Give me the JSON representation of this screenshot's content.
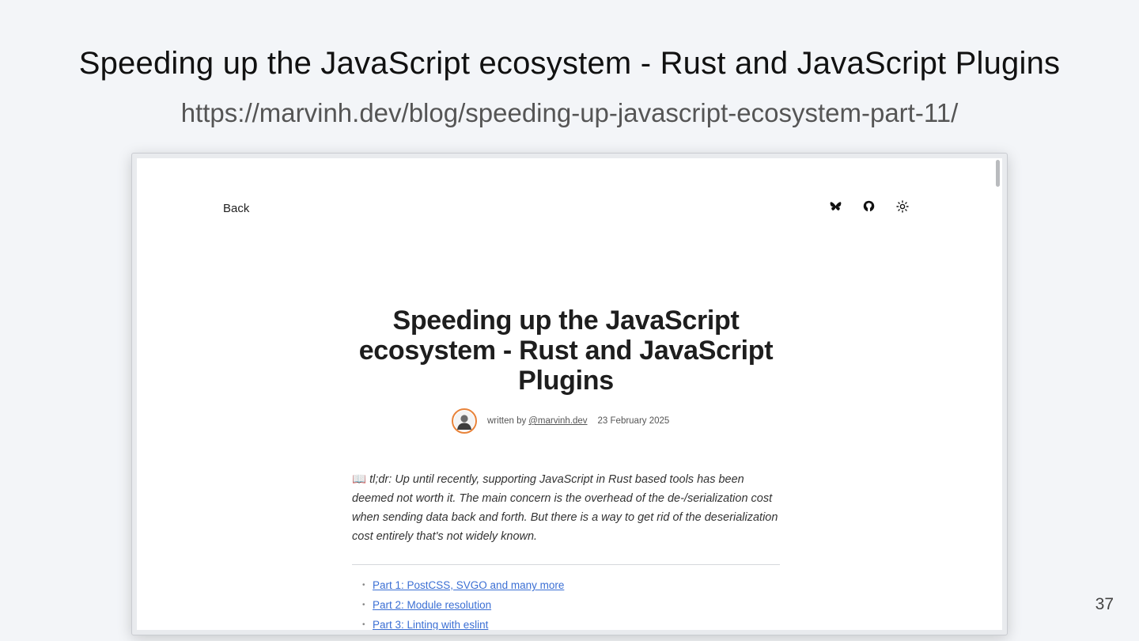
{
  "slide": {
    "title": "Speeding up the JavaScript ecosystem - Rust and JavaScript Plugins",
    "url": "https://marvinh.dev/blog/speeding-up-javascript-ecosystem-part-11/",
    "page_number": "37"
  },
  "site": {
    "back_label": "Back",
    "icons": [
      "bluesky-icon",
      "github-icon",
      "theme-toggle-icon"
    ]
  },
  "article": {
    "title": "Speeding up the JavaScript ecosystem - Rust and JavaScript Plugins",
    "byline_prefix": "written by",
    "author": "@marvinh.dev",
    "date": "23 February 2025",
    "tldr_emoji": "📖",
    "tldr": "tl;dr: Up until recently, supporting JavaScript in Rust based tools has been deemed not worth it. The main concern is the overhead of the de-/serialization cost when sending data back and forth. But there is a way to get rid of the deserialization cost entirely that's not widely known.",
    "parts": [
      "Part 1: PostCSS, SVGO and many more",
      "Part 2: Module resolution",
      "Part 3: Linting with eslint"
    ]
  },
  "colors": {
    "slide_background": "#f3f5f8",
    "link": "#3b6fd4",
    "avatar_ring": "#e8833a"
  }
}
